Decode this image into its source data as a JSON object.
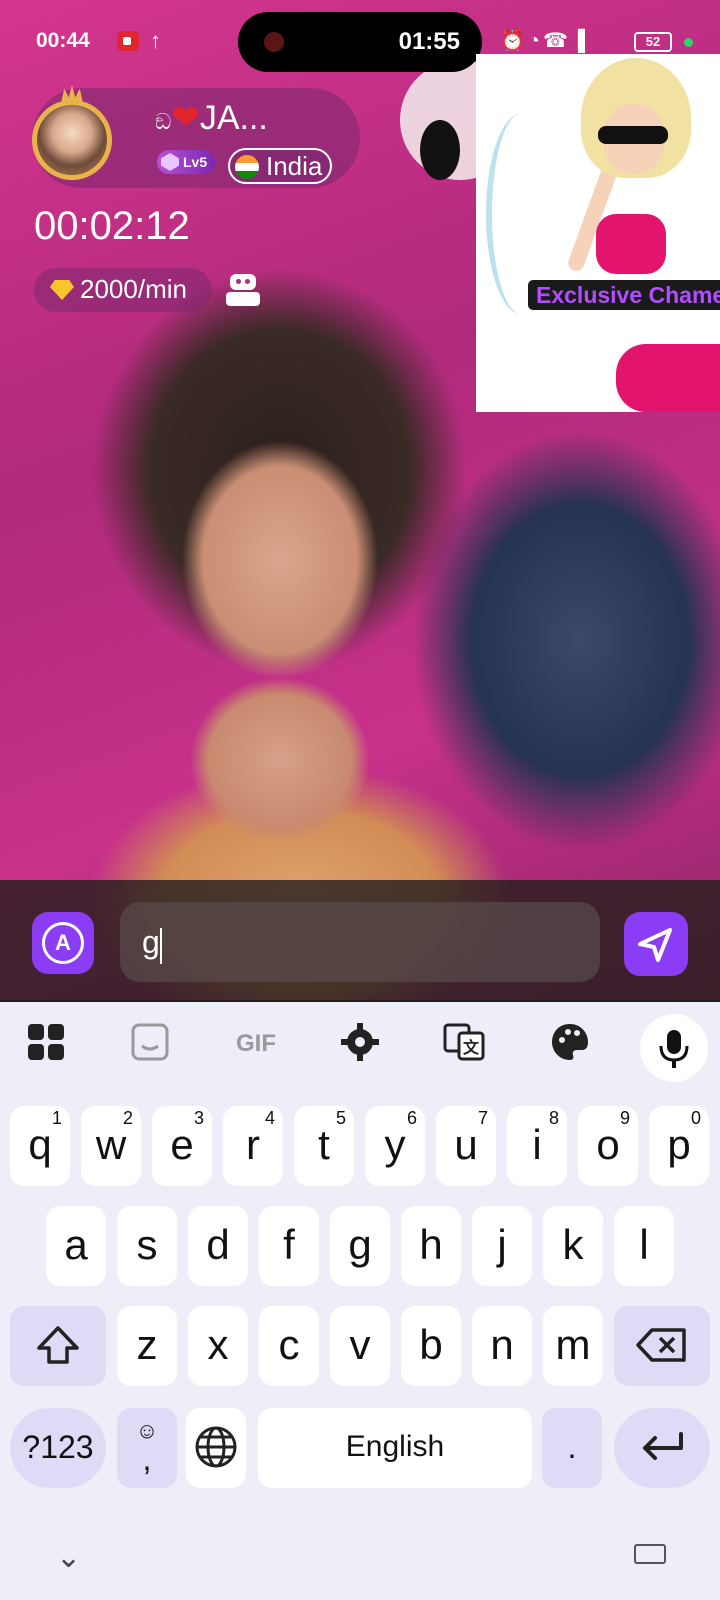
{
  "status_bar": {
    "time": "00:44",
    "battery": "52"
  },
  "recording": {
    "elapsed": "01:55"
  },
  "host": {
    "name": "JA...",
    "level": "Lv5",
    "country": "India"
  },
  "call": {
    "timer": "00:02:12",
    "rate": "2000/min"
  },
  "promo": {
    "label": "Exclusive Chamet"
  },
  "message": {
    "value": "g"
  },
  "keyboard": {
    "row1": [
      {
        "k": "q",
        "n": "1"
      },
      {
        "k": "w",
        "n": "2"
      },
      {
        "k": "e",
        "n": "3"
      },
      {
        "k": "r",
        "n": "4"
      },
      {
        "k": "t",
        "n": "5"
      },
      {
        "k": "y",
        "n": "6"
      },
      {
        "k": "u",
        "n": "7"
      },
      {
        "k": "i",
        "n": "8"
      },
      {
        "k": "o",
        "n": "9"
      },
      {
        "k": "p",
        "n": "0"
      }
    ],
    "row2": [
      "a",
      "s",
      "d",
      "f",
      "g",
      "h",
      "j",
      "k",
      "l"
    ],
    "row3": [
      "z",
      "x",
      "c",
      "v",
      "b",
      "n",
      "m"
    ],
    "symbols": "?123",
    "comma": ",",
    "space": "English",
    "period": ".",
    "toolbar_gif": "GIF"
  },
  "colors": {
    "accent": "#8a3df5",
    "keyboard_bg": "#efedf8",
    "special_key": "#e1daf6"
  }
}
